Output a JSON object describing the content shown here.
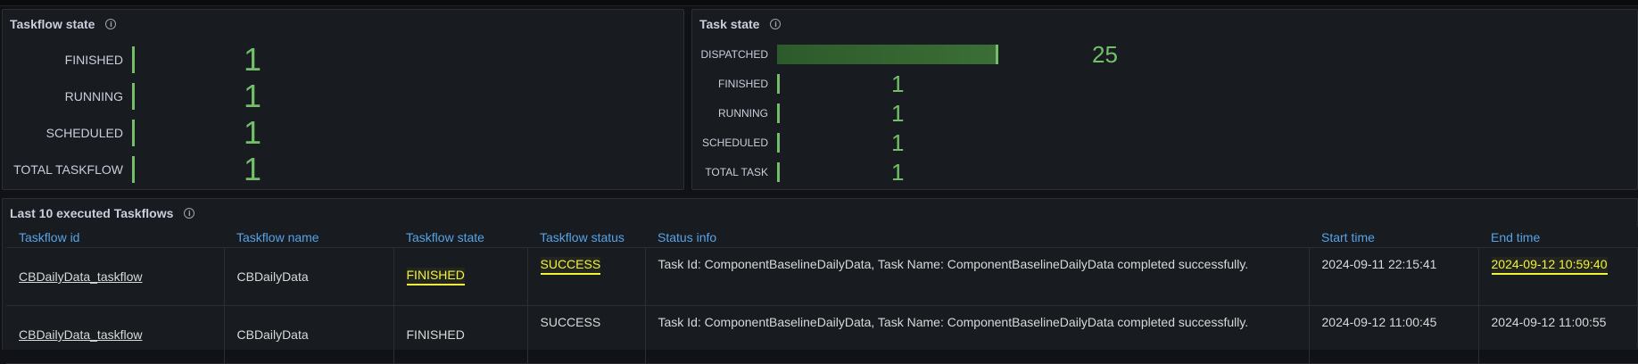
{
  "taskflow_state_panel": {
    "title": "Taskflow state",
    "rows": [
      {
        "label": "FINISHED",
        "value": "1"
      },
      {
        "label": "RUNNING",
        "value": "1"
      },
      {
        "label": "SCHEDULED",
        "value": "1"
      },
      {
        "label": "TOTAL TASKFLOW",
        "value": "1"
      }
    ]
  },
  "task_state_panel": {
    "title": "Task state",
    "rows": [
      {
        "label": "DISPATCHED",
        "value": "25"
      },
      {
        "label": "FINISHED",
        "value": "1"
      },
      {
        "label": "RUNNING",
        "value": "1"
      },
      {
        "label": "SCHEDULED",
        "value": "1"
      },
      {
        "label": "TOTAL TASK",
        "value": "1"
      }
    ]
  },
  "executed_panel": {
    "title": "Last 10 executed Taskflows",
    "columns": [
      "Taskflow id",
      "Taskflow name",
      "Taskflow state",
      "Taskflow status",
      "Status info",
      "Start time",
      "End time"
    ],
    "rows": [
      {
        "id": "CBDailyData_taskflow",
        "name": "CBDailyData",
        "state": "FINISHED",
        "status": "SUCCESS",
        "info": "Task Id: ComponentBaselineDailyData, Task Name: ComponentBaselineDailyData completed successfully.",
        "start": "2024-09-11 22:15:41",
        "end": "2024-09-12 10:59:40"
      },
      {
        "id": "CBDailyData_taskflow",
        "name": "CBDailyData",
        "state": "FINISHED",
        "status": "SUCCESS",
        "info": "Task Id: ComponentBaselineDailyData, Task Name: ComponentBaselineDailyData completed successfully.",
        "start": "2024-09-12 11:00:45",
        "end": "2024-09-12 11:00:55"
      }
    ]
  },
  "colors": {
    "value_green": "#73bf69",
    "header_blue": "#56a3e8",
    "highlight_yellow": "#f2f23a",
    "panel_bg": "#181b1f"
  },
  "icons": {
    "info": "info-circle-icon"
  }
}
